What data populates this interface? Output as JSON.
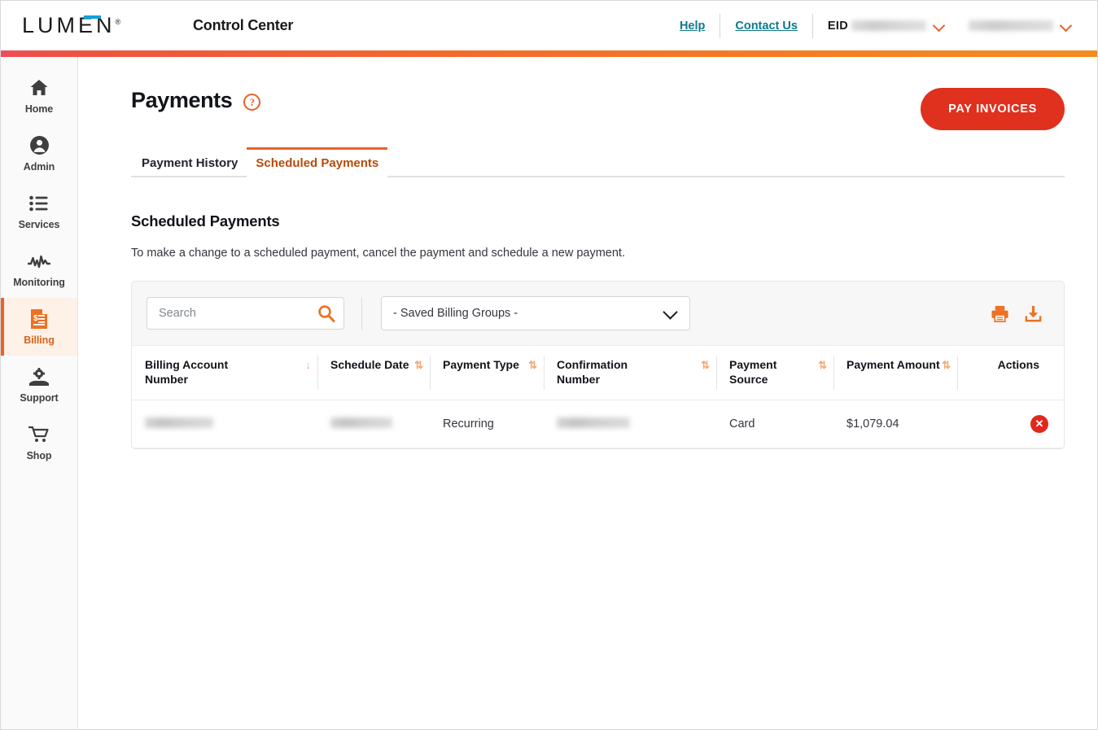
{
  "header": {
    "logo": "LUMEN",
    "logo_mark": "registered-trademark",
    "app_title": "Control Center",
    "help_link": "Help",
    "contact_link": "Contact Us",
    "eid_label": "EID",
    "eid_value": "",
    "account_value": "",
    "accent_gradient_start": "#f0533f",
    "accent_gradient_end": "#f68b1f"
  },
  "sidebar": {
    "items": [
      {
        "label": "Home",
        "icon": "home-icon",
        "active": false
      },
      {
        "label": "Admin",
        "icon": "user-circle-icon",
        "active": false
      },
      {
        "label": "Services",
        "icon": "list-icon",
        "active": false
      },
      {
        "label": "Monitoring",
        "icon": "activity-icon",
        "active": false
      },
      {
        "label": "Billing",
        "icon": "invoice-icon",
        "active": true
      },
      {
        "label": "Support",
        "icon": "hand-gear-icon",
        "active": false
      },
      {
        "label": "Shop",
        "icon": "cart-icon",
        "active": false
      }
    ],
    "active_color": "#d96318",
    "active_bg": "#fdf1e8"
  },
  "main": {
    "page_title": "Payments",
    "help_icon": "question-mark-icon",
    "pay_invoices_button": "PAY INVOICES",
    "pay_button_color": "#e0301e",
    "tabs": [
      {
        "label": "Payment History",
        "active": false
      },
      {
        "label": "Scheduled Payments",
        "active": true
      }
    ],
    "section_title": "Scheduled Payments",
    "section_description": "To make a change to a scheduled payment, cancel the payment and schedule a new payment."
  },
  "toolbar": {
    "search_placeholder": "Search",
    "search_value": "",
    "search_icon": "search-icon",
    "billing_groups_selected": "- Saved Billing Groups -",
    "print_icon": "print-icon",
    "download_icon": "download-icon"
  },
  "table": {
    "columns": [
      {
        "label": "Billing Account Number",
        "sort": "desc",
        "sort_glyph": "↓"
      },
      {
        "label": "Schedule Date",
        "sort": "none",
        "sort_glyph": "⇅"
      },
      {
        "label": "Payment Type",
        "sort": "none",
        "sort_glyph": "⇅"
      },
      {
        "label": "Confirmation Number",
        "sort": "none",
        "sort_glyph": "⇅"
      },
      {
        "label": "Payment Source",
        "sort": "none",
        "sort_glyph": "⇅"
      },
      {
        "label": "Payment Amount",
        "sort": "none",
        "sort_glyph": "⇅"
      },
      {
        "label": "Actions",
        "sort": null,
        "sort_glyph": ""
      }
    ],
    "rows": [
      {
        "billing_account_number": "",
        "schedule_date": "",
        "payment_type": "Recurring",
        "confirmation_number": "",
        "payment_source": "Card",
        "payment_amount": "$1,079.04",
        "action": "cancel-payment",
        "action_glyph": "✕"
      }
    ]
  }
}
